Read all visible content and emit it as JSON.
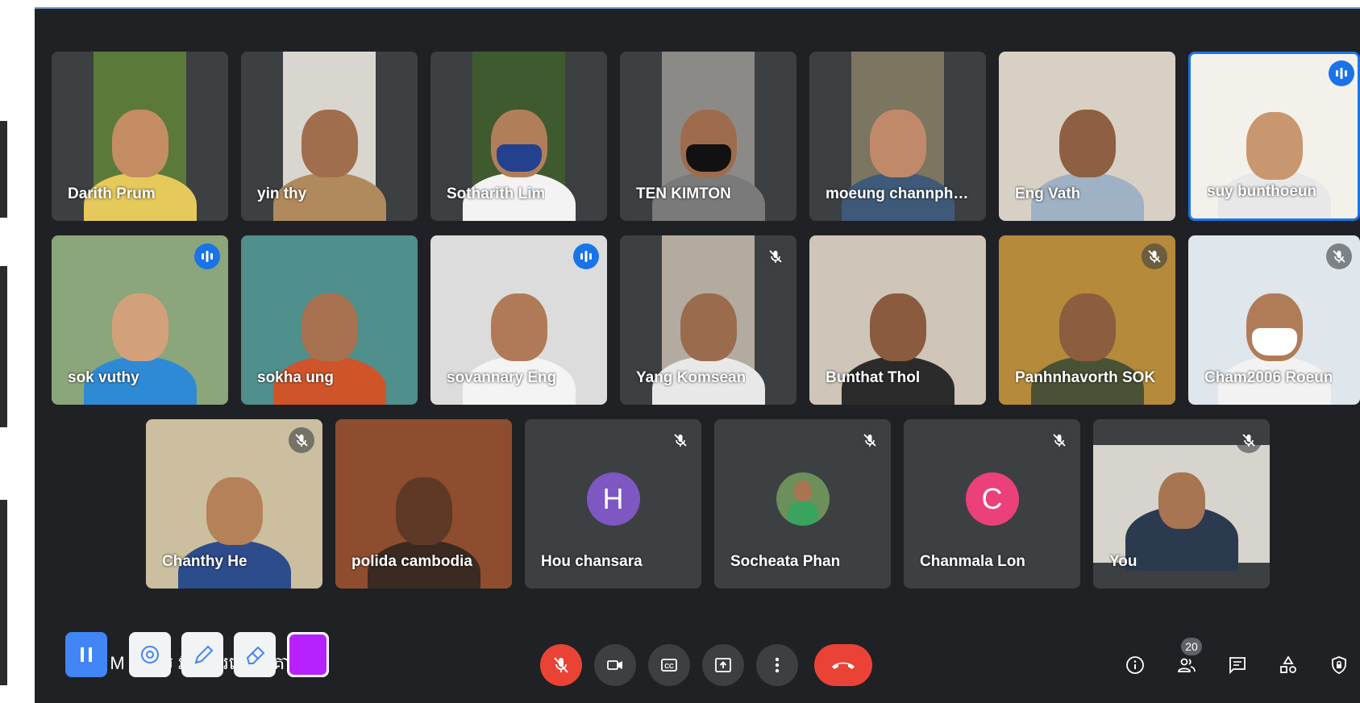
{
  "colors": {
    "meet_bg": "#202124",
    "tile_bg": "#3c4043",
    "accent": "#1a73e8",
    "end_call": "#ea4335"
  },
  "grid": {
    "row1": [
      {
        "name": "Darith Prum"
      },
      {
        "name": "yin thy"
      },
      {
        "name": "Sotharith Lim"
      },
      {
        "name": "TEN KIMTON"
      },
      {
        "name": "moeung channpha..."
      },
      {
        "name": "Eng Vath"
      },
      {
        "name": "suy bunthoeun"
      }
    ],
    "row2": [
      {
        "name": "sok vuthy"
      },
      {
        "name": "sokha ung"
      },
      {
        "name": "sovannary Eng"
      },
      {
        "name": "Yang Komsean"
      },
      {
        "name": "Bunthat Thol"
      },
      {
        "name": "Panhnhavorth SOK"
      },
      {
        "name": "Cham2006 Roeun"
      }
    ],
    "row3": [
      {
        "name": "Chanthy He"
      },
      {
        "name": "polida cambodia"
      },
      {
        "name": "Hou chansara",
        "initial": "H"
      },
      {
        "name": "Socheata Phan"
      },
      {
        "name": "Chanmala Lon",
        "initial": "C"
      },
      {
        "name": "You"
      }
    ]
  },
  "toolbar": {
    "meeting_title": "4    M   ក្ន     ពិ        ប    វត្ថីពីការរៀបចំគោ...",
    "participants_count": "20"
  }
}
